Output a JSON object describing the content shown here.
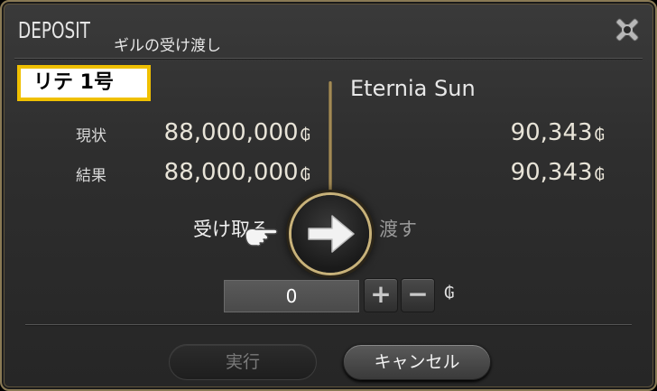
{
  "window": {
    "title_en": "DEPOSIT",
    "title_jp": "ギルの受け渡し"
  },
  "left_party": {
    "name": "リテ 1号",
    "current_amount": "88,000,000",
    "result_amount": "88,000,000"
  },
  "right_party": {
    "name": "Eternia Sun",
    "current_amount": "90,343",
    "result_amount": "90,343"
  },
  "labels": {
    "current": "現状",
    "result": "結果",
    "receive": "受け取る",
    "give": "渡す",
    "gil_symbol": "₲"
  },
  "input": {
    "value": "0",
    "plus": "+",
    "minus": "−"
  },
  "buttons": {
    "execute": "実行",
    "cancel": "キャンセル"
  },
  "colors": {
    "highlight_border": "#f0c000",
    "frame_gold": "#c8b27a"
  },
  "icons": [
    "close-icon",
    "arrow-right-icon",
    "pointing-hand-icon"
  ]
}
